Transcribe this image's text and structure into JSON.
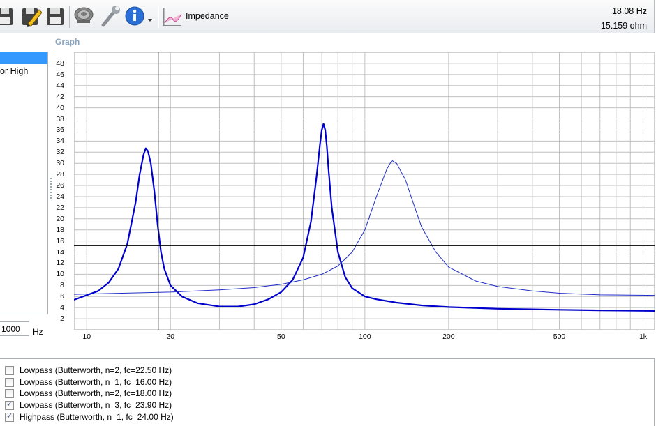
{
  "toolbar": {
    "label": "Impedance",
    "icons": [
      "save-icon",
      "edit-icon",
      "save-as-icon",
      "speaker-icon",
      "wrench-icon",
      "info-icon",
      "dropdown-arrow-icon",
      "impedance-graph-icon"
    ]
  },
  "readout": {
    "frequency": "18.08 Hz",
    "impedance": "15.159 ohm"
  },
  "left_panel": {
    "item_partial": "or High"
  },
  "frequency_input": {
    "value": "1000",
    "unit": "Hz"
  },
  "graph": {
    "title": "Graph"
  },
  "chart_data": {
    "type": "line",
    "title": "Graph",
    "x_scale": "log",
    "xlim": [
      9,
      1100
    ],
    "ylim": [
      0,
      50
    ],
    "x_ticks": [
      {
        "value": 10,
        "label": "10"
      },
      {
        "value": 20,
        "label": "20"
      },
      {
        "value": 50,
        "label": "50"
      },
      {
        "value": 100,
        "label": "100"
      },
      {
        "value": 200,
        "label": "200"
      },
      {
        "value": 500,
        "label": "500"
      },
      {
        "value": 1000,
        "label": "1k"
      }
    ],
    "y_ticks": [
      "2",
      "4",
      "6",
      "8",
      "10",
      "12",
      "14",
      "16",
      "18",
      "20",
      "22",
      "24",
      "26",
      "28",
      "30",
      "32",
      "34",
      "36",
      "38",
      "40",
      "42",
      "44",
      "46",
      "48"
    ],
    "grid": true,
    "cursor": {
      "x": 18.08,
      "y": 15.159
    },
    "series": [
      {
        "color": "#0000cc",
        "thick": true,
        "x": [
          9.0,
          11,
          12,
          13,
          14,
          15,
          15.5,
          16,
          16.3,
          16.6,
          17,
          17.5,
          18,
          18.5,
          19,
          20,
          22,
          25,
          30,
          35,
          40,
          45,
          50,
          55,
          60,
          64,
          67,
          69,
          70,
          71,
          72,
          73,
          74,
          76,
          80,
          85,
          90,
          100,
          110,
          130,
          160,
          200,
          300,
          500,
          700,
          900,
          1100
        ],
        "y": [
          5.4,
          7.0,
          8.5,
          11.0,
          15.5,
          23.0,
          28.0,
          31.5,
          32.7,
          32.2,
          30.0,
          25.0,
          18.8,
          14.0,
          11.0,
          8.0,
          6.0,
          4.8,
          4.2,
          4.2,
          4.6,
          5.5,
          6.8,
          9.0,
          13.0,
          19.5,
          27.5,
          33.5,
          36.0,
          37.1,
          36.0,
          33.0,
          29.0,
          22.0,
          14.0,
          9.5,
          7.5,
          6.0,
          5.5,
          4.9,
          4.4,
          4.1,
          3.8,
          3.6,
          3.5,
          3.45,
          3.4
        ]
      },
      {
        "color": "#1e2cc8",
        "thick": false,
        "x": [
          9.0,
          20,
          30,
          40,
          50,
          60,
          70,
          80,
          90,
          100,
          110,
          120,
          125,
          130,
          140,
          150,
          160,
          180,
          200,
          250,
          300,
          400,
          500,
          700,
          1100
        ],
        "y": [
          6.4,
          6.8,
          7.2,
          7.6,
          8.2,
          9.0,
          10.0,
          11.5,
          14.0,
          18.0,
          24.0,
          29.0,
          30.5,
          30.0,
          27.0,
          22.5,
          18.5,
          14.0,
          11.3,
          8.8,
          7.8,
          7.0,
          6.6,
          6.3,
          6.2
        ]
      }
    ]
  },
  "filters": [
    {
      "label": "Lowpass (Butterworth, n=2, fc=22.50 Hz)",
      "checked": false
    },
    {
      "label": "Lowpass (Butterworth, n=1, fc=16.00 Hz)",
      "checked": false
    },
    {
      "label": "Lowpass (Butterworth, n=2, fc=18.00 Hz)",
      "checked": false
    },
    {
      "label": "Lowpass (Butterworth, n=3, fc=23.90 Hz)",
      "checked": true
    },
    {
      "label": "Highpass (Butterworth, n=1, fc=24.00 Hz)",
      "checked": true
    }
  ]
}
